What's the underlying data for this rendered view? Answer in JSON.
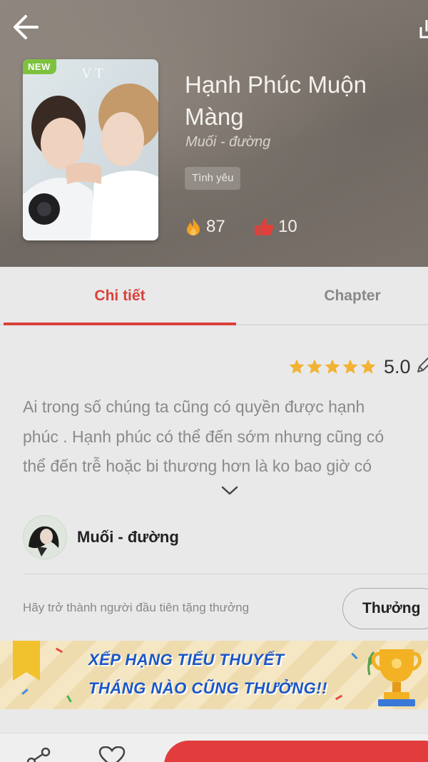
{
  "header": {
    "badge": "NEW",
    "title": "Hạnh Phúc Muộn Màng",
    "author": "Muối - đường",
    "tag": "Tình yêu",
    "fire_count": "87",
    "like_count": "10"
  },
  "tabs": [
    {
      "label": "Chi tiết",
      "active": true
    },
    {
      "label": "Chapter",
      "active": false
    }
  ],
  "rating": {
    "value": "5.0",
    "stars": 5,
    "star_color": "#f2b233"
  },
  "description": {
    "lines": [
      "Ai trong số chúng ta cũng có quyền được hạnh",
      "phúc . Hạnh phúc có thể đến sớm nhưng cũng có",
      "thể đến trễ hoặc bi thương hơn là ko bao giờ có"
    ]
  },
  "author_row": {
    "name": "Muối - đường"
  },
  "reward": {
    "prompt": "Hãy trở thành người đầu tiên tặng thưởng",
    "button_label": "Thưởng"
  },
  "banner": {
    "line1": "XẾP HẠNG TIỂU THUYẾT",
    "line2": "THÁNG NÀO CŨNG THƯỞNG!!"
  },
  "colors": {
    "accent": "#d8423a",
    "read_button": "#e23c3c",
    "banner_text": "#1a56c9"
  },
  "icons": [
    "back-arrow-icon",
    "share-icon",
    "fire-icon",
    "thumbs-up-icon",
    "star-icon",
    "edit-pencil-icon",
    "chevron-down-icon",
    "heart-icon",
    "trophy-icon",
    "ribbon-icon"
  ]
}
